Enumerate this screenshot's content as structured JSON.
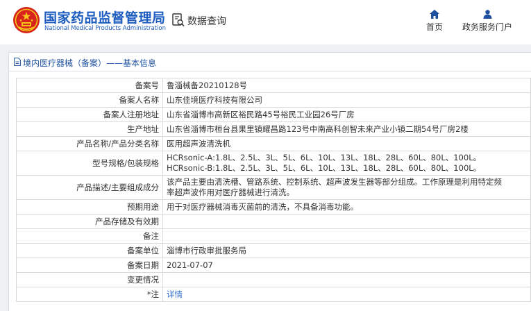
{
  "header": {
    "site_name_cn": "国家药品监督管理局",
    "site_name_en": "National Medical Products Administration",
    "data_query_label": "数据查询",
    "nav": [
      {
        "label": "首页",
        "icon": "home-icon"
      },
      {
        "label": "政务服务门户",
        "icon": "user-icon"
      }
    ]
  },
  "panel": {
    "title": "境内医疗器械（备案）——基本信息"
  },
  "rows": [
    {
      "label": "备案号",
      "value": "鲁淄械备20210128号"
    },
    {
      "label": "备案人名称",
      "value": "山东佳境医疗科技有限公司"
    },
    {
      "label": "备案人注册地址",
      "value": "山东省淄博市高新区裕民路45号裕民工业园26号厂房"
    },
    {
      "label": "生产地址",
      "value": "山东省淄博市桓台县果里镇耀昌路123号中南高科创智未来产业小镇二期54号厂房2楼"
    },
    {
      "label": "产品名称/产品分类名称",
      "value": "医用超声波清洗机"
    },
    {
      "label": "型号规格/包装规格",
      "value_lines": [
        "HCRsonic-A:1.8L、2.5L、3L、5L、6L、10L、13L、18L、28L、60L、80L、100L。",
        "HCRsonic-B:1.8L、2.5L、3L、5L、6L、10L、13L、18L、28L、60L、80L、100L。"
      ]
    },
    {
      "label": "产品描述/主要组成成分",
      "value_lines": [
        "该产品主要由清洗槽、管路系统、控制系统、超声波发生器等部分组成。工作原理是利用特定频",
        "率超声波作用对医疗器械进行清洗。"
      ]
    },
    {
      "label": "预期用途",
      "value": "用于对医疗器械消毒灭菌前的清洗，不具备消毒功能。"
    },
    {
      "label": "产品存储及有效期",
      "value": ""
    },
    {
      "label": "备注",
      "value": ""
    },
    {
      "label": "备案单位",
      "value": "淄博市行政审批服务局"
    },
    {
      "label": "备案日期",
      "value": "2021-07-07"
    },
    {
      "label": "变更情况",
      "value": ""
    },
    {
      "label": "*注",
      "value": "详情"
    }
  ],
  "colors": {
    "brand_blue": "#1d5dc0",
    "link_blue": "#2f6ccf",
    "emblem_red": "#d7231c",
    "emblem_gold": "#f5c518"
  }
}
